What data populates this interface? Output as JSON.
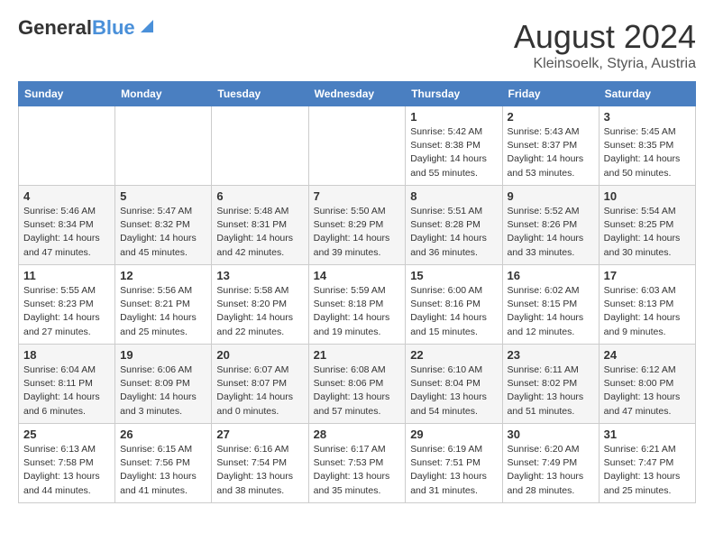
{
  "header": {
    "logo_general": "General",
    "logo_blue": "Blue",
    "month_year": "August 2024",
    "location": "Kleinsoelk, Styria, Austria"
  },
  "weekdays": [
    "Sunday",
    "Monday",
    "Tuesday",
    "Wednesday",
    "Thursday",
    "Friday",
    "Saturday"
  ],
  "weeks": [
    [
      null,
      null,
      null,
      null,
      {
        "day": 1,
        "sunrise": "5:42 AM",
        "sunset": "8:38 PM",
        "daylight": "14 hours and 55 minutes."
      },
      {
        "day": 2,
        "sunrise": "5:43 AM",
        "sunset": "8:37 PM",
        "daylight": "14 hours and 53 minutes."
      },
      {
        "day": 3,
        "sunrise": "5:45 AM",
        "sunset": "8:35 PM",
        "daylight": "14 hours and 50 minutes."
      }
    ],
    [
      {
        "day": 4,
        "sunrise": "5:46 AM",
        "sunset": "8:34 PM",
        "daylight": "14 hours and 47 minutes."
      },
      {
        "day": 5,
        "sunrise": "5:47 AM",
        "sunset": "8:32 PM",
        "daylight": "14 hours and 45 minutes."
      },
      {
        "day": 6,
        "sunrise": "5:48 AM",
        "sunset": "8:31 PM",
        "daylight": "14 hours and 42 minutes."
      },
      {
        "day": 7,
        "sunrise": "5:50 AM",
        "sunset": "8:29 PM",
        "daylight": "14 hours and 39 minutes."
      },
      {
        "day": 8,
        "sunrise": "5:51 AM",
        "sunset": "8:28 PM",
        "daylight": "14 hours and 36 minutes."
      },
      {
        "day": 9,
        "sunrise": "5:52 AM",
        "sunset": "8:26 PM",
        "daylight": "14 hours and 33 minutes."
      },
      {
        "day": 10,
        "sunrise": "5:54 AM",
        "sunset": "8:25 PM",
        "daylight": "14 hours and 30 minutes."
      }
    ],
    [
      {
        "day": 11,
        "sunrise": "5:55 AM",
        "sunset": "8:23 PM",
        "daylight": "14 hours and 27 minutes."
      },
      {
        "day": 12,
        "sunrise": "5:56 AM",
        "sunset": "8:21 PM",
        "daylight": "14 hours and 25 minutes."
      },
      {
        "day": 13,
        "sunrise": "5:58 AM",
        "sunset": "8:20 PM",
        "daylight": "14 hours and 22 minutes."
      },
      {
        "day": 14,
        "sunrise": "5:59 AM",
        "sunset": "8:18 PM",
        "daylight": "14 hours and 19 minutes."
      },
      {
        "day": 15,
        "sunrise": "6:00 AM",
        "sunset": "8:16 PM",
        "daylight": "14 hours and 15 minutes."
      },
      {
        "day": 16,
        "sunrise": "6:02 AM",
        "sunset": "8:15 PM",
        "daylight": "14 hours and 12 minutes."
      },
      {
        "day": 17,
        "sunrise": "6:03 AM",
        "sunset": "8:13 PM",
        "daylight": "14 hours and 9 minutes."
      }
    ],
    [
      {
        "day": 18,
        "sunrise": "6:04 AM",
        "sunset": "8:11 PM",
        "daylight": "14 hours and 6 minutes."
      },
      {
        "day": 19,
        "sunrise": "6:06 AM",
        "sunset": "8:09 PM",
        "daylight": "14 hours and 3 minutes."
      },
      {
        "day": 20,
        "sunrise": "6:07 AM",
        "sunset": "8:07 PM",
        "daylight": "14 hours and 0 minutes."
      },
      {
        "day": 21,
        "sunrise": "6:08 AM",
        "sunset": "8:06 PM",
        "daylight": "13 hours and 57 minutes."
      },
      {
        "day": 22,
        "sunrise": "6:10 AM",
        "sunset": "8:04 PM",
        "daylight": "13 hours and 54 minutes."
      },
      {
        "day": 23,
        "sunrise": "6:11 AM",
        "sunset": "8:02 PM",
        "daylight": "13 hours and 51 minutes."
      },
      {
        "day": 24,
        "sunrise": "6:12 AM",
        "sunset": "8:00 PM",
        "daylight": "13 hours and 47 minutes."
      }
    ],
    [
      {
        "day": 25,
        "sunrise": "6:13 AM",
        "sunset": "7:58 PM",
        "daylight": "13 hours and 44 minutes."
      },
      {
        "day": 26,
        "sunrise": "6:15 AM",
        "sunset": "7:56 PM",
        "daylight": "13 hours and 41 minutes."
      },
      {
        "day": 27,
        "sunrise": "6:16 AM",
        "sunset": "7:54 PM",
        "daylight": "13 hours and 38 minutes."
      },
      {
        "day": 28,
        "sunrise": "6:17 AM",
        "sunset": "7:53 PM",
        "daylight": "13 hours and 35 minutes."
      },
      {
        "day": 29,
        "sunrise": "6:19 AM",
        "sunset": "7:51 PM",
        "daylight": "13 hours and 31 minutes."
      },
      {
        "day": 30,
        "sunrise": "6:20 AM",
        "sunset": "7:49 PM",
        "daylight": "13 hours and 28 minutes."
      },
      {
        "day": 31,
        "sunrise": "6:21 AM",
        "sunset": "7:47 PM",
        "daylight": "13 hours and 25 minutes."
      }
    ]
  ],
  "labels": {
    "sunrise": "Sunrise:",
    "sunset": "Sunset:",
    "daylight": "Daylight:"
  }
}
